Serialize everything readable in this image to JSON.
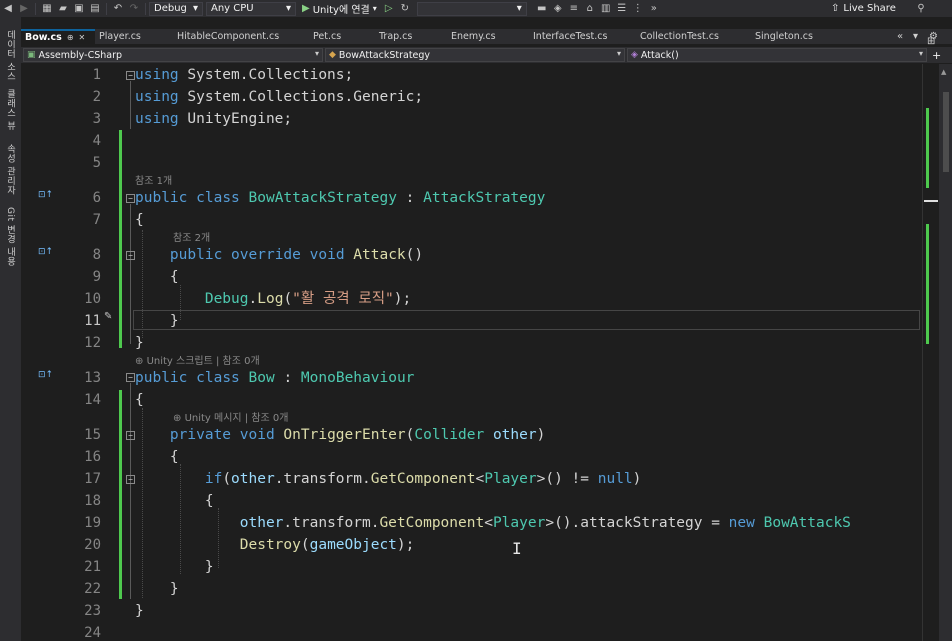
{
  "toolbar": {
    "config": "Debug",
    "platform": "Any CPU",
    "run_label": "Unity에 연결",
    "live_share": "Live Share"
  },
  "side_panels": [
    "데이터 소스",
    "클래스 뷰",
    "속성 관리자",
    "Git 변경 내용"
  ],
  "tabs": [
    {
      "label": "Bow.cs",
      "active": true
    },
    {
      "label": "Player.cs"
    },
    {
      "label": "HitableComponent.cs"
    },
    {
      "label": "Pet.cs"
    },
    {
      "label": "Trap.cs"
    },
    {
      "label": "Enemy.cs"
    },
    {
      "label": "InterfaceTest.cs"
    },
    {
      "label": "CollectionTest.cs"
    },
    {
      "label": "Singleton.cs"
    }
  ],
  "navbar": {
    "project": "Assembly-CSharp",
    "type": "BowAttackStrategy",
    "member": "Attack()"
  },
  "lens": {
    "line6": "참조 1개",
    "line8": "참조 2개",
    "line13": "Unity 스크립트 | 참조 0개",
    "line15": "Unity 메시지 | 참조 0개"
  },
  "lines": [
    "using System.Collections;",
    "using System.Collections.Generic;",
    "using UnityEngine;",
    "",
    "",
    "public class BowAttackStrategy : AttackStrategy",
    "{",
    "    public override void Attack()",
    "    {",
    "        Debug.Log(\"활 공격 로직\");",
    "    }",
    "}",
    "public class Bow : MonoBehaviour",
    "{",
    "    private void OnTriggerEnter(Collider other)",
    "    {",
    "        if(other.transform.GetComponent<Player>() != null)",
    "        {",
    "            other.transform.GetComponent<Player>().attackStrategy = new BowAttackS",
    "            Destroy(gameObject);",
    "        }",
    "    }",
    "}",
    ""
  ],
  "line_numbers": [
    "1",
    "2",
    "3",
    "4",
    "5",
    "6",
    "7",
    "8",
    "9",
    "10",
    "11",
    "12",
    "13",
    "14",
    "15",
    "16",
    "17",
    "18",
    "19",
    "20",
    "21",
    "22",
    "23",
    "24"
  ],
  "current_line": 11,
  "colors": {
    "keyword": "#569cd6",
    "type": "#4ec9b0",
    "method": "#dcdcaa",
    "string": "#d69d85",
    "identifier": "#9cdcfe",
    "change_bar": "#4ec94e"
  }
}
